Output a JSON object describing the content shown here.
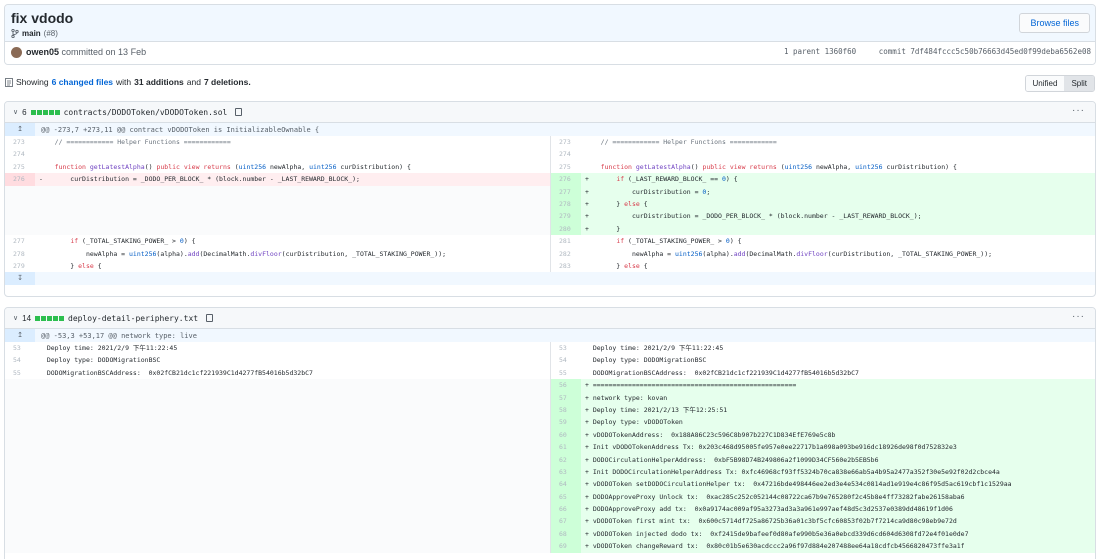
{
  "commit": {
    "title": "fix vdodo",
    "branch": "main",
    "pr": "(#8)",
    "browse_label": "Browse files",
    "author": "owen05",
    "committed_text": "committed on 13 Feb",
    "parent_label": "1 parent",
    "parent_sha": "1360f60",
    "commit_label": "commit",
    "commit_sha": "7df484fccc5c50b76663d45ed0f99deba6562e08"
  },
  "summary": {
    "showing": "Showing",
    "changed_files": "6 changed files",
    "with": "with",
    "additions": "31 additions",
    "and": "and",
    "deletions": "7 deletions."
  },
  "view_toggle": {
    "unified": "Unified",
    "split": "Split",
    "active": "Split"
  },
  "files": [
    {
      "count": "6",
      "path": "contracts/DODOToken/vDODOToken.sol",
      "hunk": "@@ -273,7 +273,11 @@ contract vDODOToken is InitializableOwnable {",
      "left": [
        {
          "ln": "273",
          "code": "    // ============ Helper Functions ============",
          "type": ""
        },
        {
          "ln": "274",
          "code": "",
          "type": ""
        },
        {
          "ln": "275",
          "code": "    function getLatestAlpha() public view returns (uint256 newAlpha, uint256 curDistribution) {",
          "type": ""
        },
        {
          "ln": "276",
          "code": "-       curDistribution = _DODO_PER_BLOCK_ * (block.number - _LAST_REWARD_BLOCK_);",
          "type": "del"
        },
        {
          "ln": "",
          "code": "",
          "type": "empty"
        },
        {
          "ln": "",
          "code": "",
          "type": "empty"
        },
        {
          "ln": "",
          "code": "",
          "type": "empty"
        },
        {
          "ln": "",
          "code": "",
          "type": "empty"
        },
        {
          "ln": "277",
          "code": "        if (_TOTAL_STAKING_POWER_ > 0) {",
          "type": ""
        },
        {
          "ln": "278",
          "code": "            newAlpha = uint256(alpha).add(DecimalMath.divFloor(curDistribution, _TOTAL_STAKING_POWER_));",
          "type": ""
        },
        {
          "ln": "279",
          "code": "        } else {",
          "type": ""
        }
      ],
      "right": [
        {
          "ln": "273",
          "code": "    // ============ Helper Functions ============",
          "type": ""
        },
        {
          "ln": "274",
          "code": "",
          "type": ""
        },
        {
          "ln": "275",
          "code": "    function getLatestAlpha() public view returns (uint256 newAlpha, uint256 curDistribution) {",
          "type": ""
        },
        {
          "ln": "276",
          "code": "+       if (_LAST_REWARD_BLOCK_ == 0) {",
          "type": "add"
        },
        {
          "ln": "277",
          "code": "+           curDistribution = 0;",
          "type": "add"
        },
        {
          "ln": "278",
          "code": "+       } else {",
          "type": "add"
        },
        {
          "ln": "279",
          "code": "+           curDistribution = _DODO_PER_BLOCK_ * (block.number - _LAST_REWARD_BLOCK_);",
          "type": "add"
        },
        {
          "ln": "280",
          "code": "+       }",
          "type": "add"
        },
        {
          "ln": "281",
          "code": "        if (_TOTAL_STAKING_POWER_ > 0) {",
          "type": ""
        },
        {
          "ln": "282",
          "code": "            newAlpha = uint256(alpha).add(DecimalMath.divFloor(curDistribution, _TOTAL_STAKING_POWER_));",
          "type": ""
        },
        {
          "ln": "283",
          "code": "        } else {",
          "type": ""
        }
      ]
    },
    {
      "count": "14",
      "path": "deploy-detail-periphery.txt",
      "hunk": "@@ -53,3 +53,17 @@ network type: live",
      "left": [
        {
          "ln": "53",
          "code": "  Deploy time: 2021/2/9 下午11:22:45",
          "type": ""
        },
        {
          "ln": "54",
          "code": "  Deploy type: DODOMigrationBSC",
          "type": ""
        },
        {
          "ln": "55",
          "code": "  DODOMigrationBSCAddress:  0x02fCB21dc1cf221939C1d4277fB54016b5d32bC7",
          "type": ""
        },
        {
          "ln": "",
          "code": "",
          "type": "empty"
        },
        {
          "ln": "",
          "code": "",
          "type": "empty"
        },
        {
          "ln": "",
          "code": "",
          "type": "empty"
        },
        {
          "ln": "",
          "code": "",
          "type": "empty"
        },
        {
          "ln": "",
          "code": "",
          "type": "empty"
        },
        {
          "ln": "",
          "code": "",
          "type": "empty"
        },
        {
          "ln": "",
          "code": "",
          "type": "empty"
        },
        {
          "ln": "",
          "code": "",
          "type": "empty"
        },
        {
          "ln": "",
          "code": "",
          "type": "empty"
        },
        {
          "ln": "",
          "code": "",
          "type": "empty"
        },
        {
          "ln": "",
          "code": "",
          "type": "empty"
        },
        {
          "ln": "",
          "code": "",
          "type": "empty"
        },
        {
          "ln": "",
          "code": "",
          "type": "empty"
        },
        {
          "ln": "",
          "code": "",
          "type": "empty"
        }
      ],
      "right": [
        {
          "ln": "53",
          "code": "  Deploy time: 2021/2/9 下午11:22:45",
          "type": ""
        },
        {
          "ln": "54",
          "code": "  Deploy type: DODOMigrationBSC",
          "type": ""
        },
        {
          "ln": "55",
          "code": "  DODOMigrationBSCAddress:  0x02fCB21dc1cf221939C1d4277fB54016b5d32bC7",
          "type": ""
        },
        {
          "ln": "56",
          "code": "+ ====================================================",
          "type": "add"
        },
        {
          "ln": "57",
          "code": "+ network type: kovan",
          "type": "add"
        },
        {
          "ln": "58",
          "code": "+ Deploy time: 2021/2/13 下午12:25:51",
          "type": "add"
        },
        {
          "ln": "59",
          "code": "+ Deploy type: vDODOToken",
          "type": "add"
        },
        {
          "ln": "60",
          "code": "+ vDODOTokenAddress:  0x188A86C23c596C8b907b227C1D834EfE769e5c8b",
          "type": "add"
        },
        {
          "ln": "61",
          "code": "+ Init vDODOTokenAddress Tx: 0x203c468d95005fe957e0ee22717b1a098a093be916dc18926de98f0d752832e3",
          "type": "add"
        },
        {
          "ln": "62",
          "code": "+ DODOCirculationHelperAddress:  0xbF5B98D74B249806a2f1099D34CF560e2b5EB5b6",
          "type": "add"
        },
        {
          "ln": "63",
          "code": "+ Init DODOCirculationHelperAddress Tx: 0xfc46968cf93ff5324b70ca838e66ab5a4b95a2477a352f30e5e92f02d2cbce4a",
          "type": "add"
        },
        {
          "ln": "64",
          "code": "+ vDODOToken setDODOCirculationHelper tx:  0x47216bde498446ee2ed3e4e534c0814ad1e919e4c86f95d5ac619cbf1c1529aa",
          "type": "add"
        },
        {
          "ln": "65",
          "code": "+ DODOApproveProxy Unlock tx:  0xac285c252c052144c08722ca67b9e765280f2c45b8e4ff73282fabe26158aba6",
          "type": "add"
        },
        {
          "ln": "66",
          "code": "+ DODOApproveProxy add tx:  0x0a9174ac009af95a3273ad3a3a961e997aef48d5c3d2537e0389dd48619f1d06",
          "type": "add"
        },
        {
          "ln": "67",
          "code": "+ vDODOToken first mint tx:  0x600c5714df725a86725b36a01c3bf5cfc60853f02b7f7214ca9d80c98eb9e72d",
          "type": "add"
        },
        {
          "ln": "68",
          "code": "+ vDODOToken injected dodo tx:  0xf2415de9bafeef0d80afe990b5e36a0ebcd339d6cd604d6308fd72e4f01e0de7",
          "type": "add"
        },
        {
          "ln": "69",
          "code": "+ vDODOToken changeReward tx:  0x80c01b5e630acdccc2a96f97d884e207488ee64a18cdfcb4566820473ffe3a1f",
          "type": "add"
        }
      ]
    }
  ],
  "icons": {
    "branch": "git-branch-icon",
    "copy": "clipboard-icon",
    "chevron": "chevron-down-icon",
    "expand": "unfold-icon",
    "more": "kebab-horizontal-icon",
    "file": "file-diff-icon"
  },
  "colors": {
    "link": "#0366d6",
    "add_bg": "#e6ffed",
    "del_bg": "#ffeef0",
    "hunk_bg": "#f1f8ff"
  }
}
